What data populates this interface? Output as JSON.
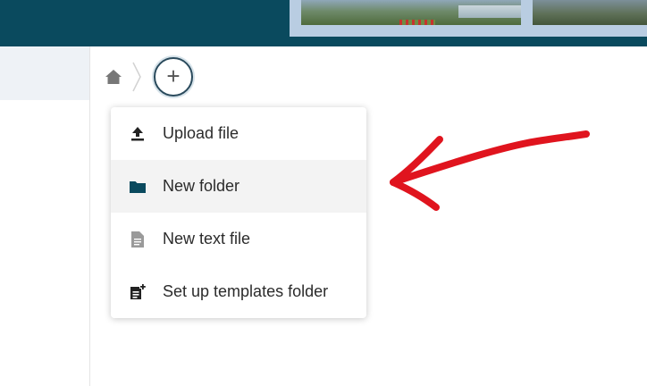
{
  "colors": {
    "header": "#0a4a5e",
    "accent": "#2a4a5c",
    "annotation": "#e0141e",
    "menu_highlight": "#f3f3f3"
  },
  "breadcrumb": {
    "home_icon": "home-icon",
    "add_icon": "plus-icon",
    "add_symbol": "+"
  },
  "new_menu": {
    "items": [
      {
        "label": "Upload file",
        "icon": "upload-icon"
      },
      {
        "label": "New folder",
        "icon": "folder-icon",
        "highlighted": true
      },
      {
        "label": "New text file",
        "icon": "text-file-icon"
      },
      {
        "label": "Set up templates folder",
        "icon": "template-folder-icon"
      }
    ]
  },
  "annotation": {
    "type": "hand-drawn-arrow",
    "points_to": "New folder"
  }
}
